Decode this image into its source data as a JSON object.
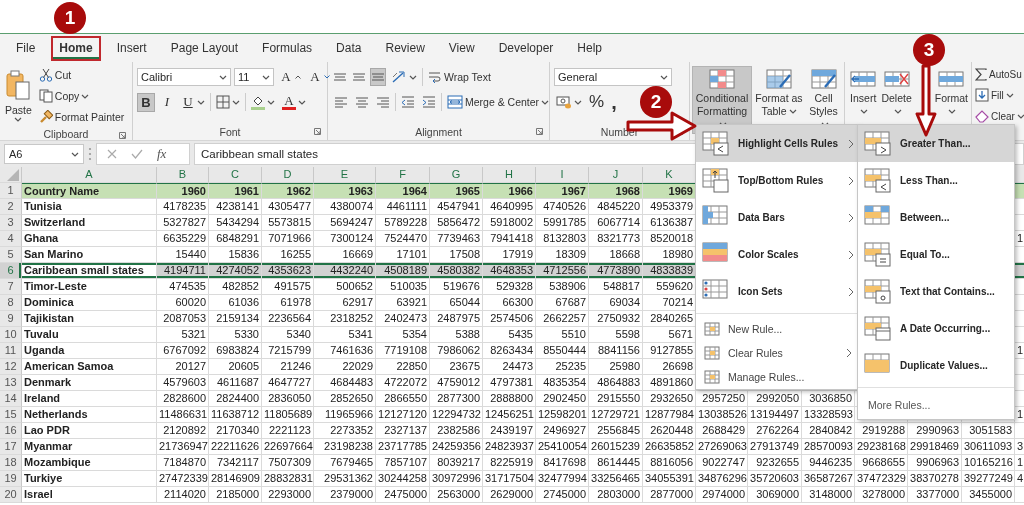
{
  "annotations": [
    {
      "label": "1"
    },
    {
      "label": "2"
    },
    {
      "label": "3"
    }
  ],
  "tabs": [
    {
      "label": "File",
      "selected": false,
      "boxed": false
    },
    {
      "label": "Home",
      "selected": true,
      "boxed": true
    },
    {
      "label": "Insert",
      "selected": false,
      "boxed": false
    },
    {
      "label": "Page Layout",
      "selected": false,
      "boxed": false
    },
    {
      "label": "Formulas",
      "selected": false,
      "boxed": false
    },
    {
      "label": "Data",
      "selected": false,
      "boxed": false
    },
    {
      "label": "Review",
      "selected": false,
      "boxed": false
    },
    {
      "label": "View",
      "selected": false,
      "boxed": false
    },
    {
      "label": "Developer",
      "selected": false,
      "boxed": false
    },
    {
      "label": "Help",
      "selected": false,
      "boxed": false
    }
  ],
  "ribbon": {
    "clipboard": {
      "paste": "Paste",
      "cut": "Cut",
      "copy": "Copy",
      "format_painter": "Format Painter",
      "label": "Clipboard"
    },
    "font": {
      "name": "Calibri",
      "size": "11",
      "grow": "A",
      "shrink": "A",
      "bold": {
        "label": "B",
        "selected": true
      },
      "italic": {
        "label": "I",
        "selected": false
      },
      "underline": {
        "label": "U",
        "selected": false
      },
      "font_color": "A",
      "label": "Font"
    },
    "alignment": {
      "vertical": [
        {
          "selected": false
        },
        {
          "selected": false
        },
        {
          "selected": true
        }
      ],
      "wrap_text": "Wrap Text",
      "merge": "Merge & Center",
      "label": "Alignment"
    },
    "number": {
      "format": "General",
      "percent": "%",
      "comma": ",",
      "label": "Number"
    },
    "styles": {
      "buttons": [
        {
          "label": "Conditional Formatting",
          "selected": true
        },
        {
          "label": "Format as Table",
          "selected": false
        },
        {
          "label": "Cell Styles",
          "selected": false
        }
      ]
    },
    "cells": {
      "buttons": [
        {
          "label": "Insert"
        },
        {
          "label": "Delete"
        },
        {
          "label": "Format"
        }
      ]
    },
    "editing": {
      "autosum": "AutoSu",
      "fill": "Fill",
      "clear": "Clear"
    }
  },
  "formula_bar": {
    "name_box": "A6",
    "function_label": "fx",
    "formula": "Caribbean small states"
  },
  "sheet": {
    "columns": [
      "A",
      "B",
      "C",
      "D",
      "E",
      "F",
      "G",
      "H",
      "I",
      "J",
      "K"
    ],
    "rows": [
      {
        "number": "1",
        "kind": "header",
        "selected": false,
        "name": "Country Name",
        "values": [
          "1960",
          "1961",
          "1962",
          "1963",
          "1964",
          "1965",
          "1966",
          "1967",
          "1968",
          "1969"
        ]
      },
      {
        "number": "2",
        "kind": "data",
        "selected": false,
        "name": "Tunisia",
        "values": [
          "4178235",
          "4238141",
          "4305477",
          "4380074",
          "4461111",
          "4547941",
          "4640995",
          "4740526",
          "4845220",
          "4953379"
        ]
      },
      {
        "number": "3",
        "kind": "data",
        "selected": false,
        "name": "Switzerland",
        "values": [
          "5327827",
          "5434294",
          "5573815",
          "5694247",
          "5789228",
          "5856472",
          "5918002",
          "5991785",
          "6067714",
          "6136387"
        ]
      },
      {
        "number": "4",
        "kind": "data",
        "selected": false,
        "name": "Ghana",
        "values": [
          "6635229",
          "6848291",
          "7071966",
          "7300124",
          "7524470",
          "7739463",
          "7941418",
          "8132803",
          "8321773",
          "8520018"
        ],
        "edge": "1"
      },
      {
        "number": "5",
        "kind": "data",
        "selected": false,
        "name": "San Marino",
        "values": [
          "15440",
          "15836",
          "16255",
          "16669",
          "17101",
          "17508",
          "17919",
          "18309",
          "18668",
          "18980"
        ]
      },
      {
        "number": "6",
        "kind": "data",
        "selected": true,
        "name": "Caribbean small states",
        "values": [
          "4194711",
          "4274052",
          "4353623",
          "4432240",
          "4508189",
          "4580382",
          "4648353",
          "4712556",
          "4773890",
          "4833839"
        ]
      },
      {
        "number": "7",
        "kind": "data",
        "selected": false,
        "name": "Timor-Leste",
        "values": [
          "474535",
          "482852",
          "491575",
          "500652",
          "510035",
          "519676",
          "529328",
          "538906",
          "548817",
          "559620"
        ]
      },
      {
        "number": "8",
        "kind": "data",
        "selected": false,
        "name": "Dominica",
        "values": [
          "60020",
          "61036",
          "61978",
          "62917",
          "63921",
          "65044",
          "66300",
          "67687",
          "69034",
          "70214"
        ]
      },
      {
        "number": "9",
        "kind": "data",
        "selected": false,
        "name": "Tajikistan",
        "values": [
          "2087053",
          "2159134",
          "2236564",
          "2318252",
          "2402473",
          "2487975",
          "2574506",
          "2662257",
          "2750932",
          "2840265"
        ]
      },
      {
        "number": "10",
        "kind": "data",
        "selected": false,
        "name": "Tuvalu",
        "values": [
          "5321",
          "5330",
          "5340",
          "5341",
          "5354",
          "5388",
          "5435",
          "5510",
          "5598",
          "5671"
        ]
      },
      {
        "number": "11",
        "kind": "data",
        "selected": false,
        "name": "Uganda",
        "values": [
          "6767092",
          "6983824",
          "7215799",
          "7461636",
          "7719108",
          "7986062",
          "8263434",
          "8550444",
          "8841156",
          "9127855"
        ],
        "edge": "1"
      },
      {
        "number": "12",
        "kind": "data",
        "selected": false,
        "name": "American Samoa",
        "values": [
          "20127",
          "20605",
          "21246",
          "22029",
          "22850",
          "23675",
          "24473",
          "25235",
          "25980",
          "26698"
        ]
      },
      {
        "number": "13",
        "kind": "data",
        "selected": false,
        "name": "Denmark",
        "values": [
          "4579603",
          "4611687",
          "4647727",
          "4684483",
          "4722072",
          "4759012",
          "4797381",
          "4835354",
          "4864883",
          "4891860"
        ]
      },
      {
        "number": "14",
        "kind": "data",
        "selected": false,
        "name": "Ireland",
        "values": [
          "2828600",
          "2824400",
          "2836050",
          "2852650",
          "2866550",
          "2877300",
          "2888800",
          "2902450",
          "2915550",
          "2932650"
        ],
        "more": [
          "2957250",
          "2992050",
          "3036850"
        ]
      },
      {
        "number": "15",
        "kind": "data",
        "selected": false,
        "name": "Netherlands",
        "values": [
          "11486631",
          "11638712",
          "11805689",
          "11965966",
          "12127120",
          "12294732",
          "12456251",
          "12598201",
          "12729721",
          "12877984"
        ],
        "more": [
          "13038526",
          "13194497",
          "13328593"
        ],
        "edge": "1"
      },
      {
        "number": "16",
        "kind": "data",
        "selected": false,
        "name": "Lao PDR",
        "values": [
          "2120892",
          "2170340",
          "2221123",
          "2273352",
          "2327137",
          "2382586",
          "2439197",
          "2496927",
          "2556845",
          "2620448"
        ],
        "more": [
          "2688429",
          "2762264",
          "2840842",
          "2919288",
          "2990963",
          "3051583"
        ]
      },
      {
        "number": "17",
        "kind": "data",
        "selected": false,
        "name": "Myanmar",
        "values": [
          "21736947",
          "22211626",
          "22697664",
          "23198238",
          "23717785",
          "24259356",
          "24823937",
          "25410054",
          "26015239",
          "26635852"
        ],
        "more": [
          "27269063",
          "27913749",
          "28570093",
          "29238168",
          "29918469",
          "30611093"
        ],
        "edge": "3"
      },
      {
        "number": "18",
        "kind": "data",
        "selected": false,
        "name": "Mozambique",
        "values": [
          "7184870",
          "7342117",
          "7507309",
          "7679465",
          "7857107",
          "8039217",
          "8225919",
          "8417698",
          "8614445",
          "8816056"
        ],
        "more": [
          "9022747",
          "9232655",
          "9446235",
          "9668655",
          "9906963",
          "10165216"
        ],
        "edge": "1"
      },
      {
        "number": "19",
        "kind": "data",
        "selected": false,
        "name": "Turkiye",
        "values": [
          "27472339",
          "28146909",
          "28832831",
          "29531362",
          "30244258",
          "30972996",
          "31717504",
          "32477994",
          "33256465",
          "34055391"
        ],
        "more": [
          "34876296",
          "35720603",
          "36587267",
          "37472329",
          "38370278",
          "39277249"
        ],
        "edge": "4"
      },
      {
        "number": "20",
        "kind": "data",
        "selected": false,
        "name": "Israel",
        "values": [
          "2114020",
          "2185000",
          "2293000",
          "2379000",
          "2475000",
          "2563000",
          "2629000",
          "2745000",
          "2803000",
          "2877000"
        ],
        "more": [
          "2974000",
          "3069000",
          "3148000",
          "3278000",
          "3377000",
          "3455000"
        ]
      }
    ]
  },
  "conditional_menu": {
    "items": [
      {
        "label": "Highlight Cells Rules",
        "kind": "large",
        "selected": true,
        "has_submenu": true
      },
      {
        "label": "Top/Bottom Rules",
        "kind": "large",
        "selected": false,
        "has_submenu": true
      },
      {
        "label": "Data Bars",
        "kind": "large",
        "selected": false,
        "has_submenu": true
      },
      {
        "label": "Color Scales",
        "kind": "large",
        "selected": false,
        "has_submenu": true
      },
      {
        "label": "Icon Sets",
        "kind": "large",
        "selected": false,
        "has_submenu": true
      },
      {
        "label": "New Rule...",
        "kind": "small",
        "selected": false,
        "has_submenu": false
      },
      {
        "label": "Clear Rules",
        "kind": "small",
        "selected": false,
        "has_submenu": true
      },
      {
        "label": "Manage Rules...",
        "kind": "small",
        "selected": false,
        "has_submenu": false
      }
    ]
  },
  "highlight_submenu": {
    "items": [
      {
        "label": "Greater Than...",
        "kind": "large",
        "selected": true
      },
      {
        "label": "Less Than...",
        "kind": "large",
        "selected": false
      },
      {
        "label": "Between...",
        "kind": "large",
        "selected": false
      },
      {
        "label": "Equal To...",
        "kind": "large",
        "selected": false
      },
      {
        "label": "Text that Contains...",
        "kind": "large",
        "selected": false
      },
      {
        "label": "A Date Occurring...",
        "kind": "large",
        "selected": false
      },
      {
        "label": "Duplicate Values...",
        "kind": "large",
        "selected": false
      },
      {
        "label": "More Rules...",
        "kind": "link",
        "selected": false
      }
    ]
  }
}
